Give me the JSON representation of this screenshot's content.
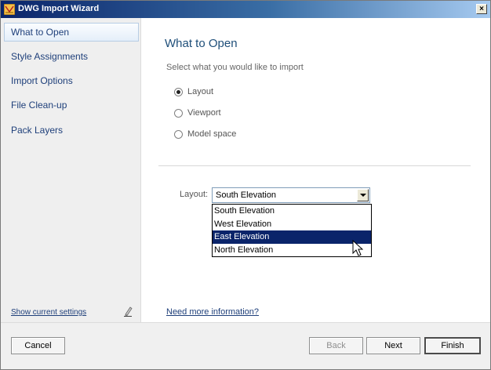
{
  "window": {
    "title": "DWG Import Wizard",
    "close_label": "×"
  },
  "sidebar": {
    "items": [
      {
        "label": "What to Open",
        "selected": true
      },
      {
        "label": "Style Assignments"
      },
      {
        "label": "Import Options"
      },
      {
        "label": "File Clean-up"
      },
      {
        "label": "Pack Layers"
      }
    ],
    "show_settings_link": "Show current settings"
  },
  "main": {
    "title": "What to Open",
    "subtitle": "Select what you would like to import",
    "options": [
      {
        "label": "Layout",
        "checked": true
      },
      {
        "label": "Viewport",
        "checked": false
      },
      {
        "label": "Model space",
        "checked": false
      }
    ],
    "layout_field": {
      "label": "Layout:",
      "selected": "South Elevation",
      "options": [
        "South Elevation",
        "West Elevation",
        "East Elevation",
        "North Elevation"
      ],
      "highlighted": "East Elevation"
    },
    "more_info_link": "Need more information?"
  },
  "footer": {
    "cancel_label": "Cancel",
    "back_label": "Back",
    "next_label": "Next",
    "finish_label": "Finish"
  },
  "colors": {
    "highlight": "#0a246a",
    "link": "#1e3f7a",
    "title": "#1e4e79"
  },
  "icons": {
    "app": "dwg-app-icon",
    "settings": "pen-icon",
    "cursor": "mouse-pointer-icon"
  }
}
